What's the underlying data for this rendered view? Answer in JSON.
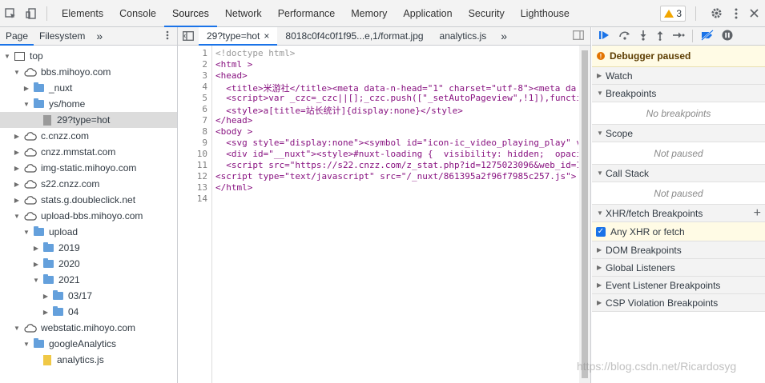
{
  "topbar": {
    "tabs": [
      "Elements",
      "Console",
      "Sources",
      "Network",
      "Performance",
      "Memory",
      "Application",
      "Security",
      "Lighthouse"
    ],
    "warning_count": "3"
  },
  "navigator": {
    "tabs": [
      "Page",
      "Filesystem"
    ],
    "more": "»",
    "tree": [
      {
        "label": "top",
        "type": "frame",
        "depth": 0,
        "open": true
      },
      {
        "label": "bbs.mihoyo.com",
        "type": "cloud",
        "depth": 1,
        "open": true
      },
      {
        "label": "_nuxt",
        "type": "folder",
        "depth": 2,
        "open": false
      },
      {
        "label": "ys/home",
        "type": "folder",
        "depth": 2,
        "open": true
      },
      {
        "label": "29?type=hot",
        "type": "file-gray",
        "depth": 3,
        "selected": true
      },
      {
        "label": "c.cnzz.com",
        "type": "cloud",
        "depth": 1,
        "open": false
      },
      {
        "label": "cnzz.mmstat.com",
        "type": "cloud",
        "depth": 1,
        "open": false
      },
      {
        "label": "img-static.mihoyo.com",
        "type": "cloud",
        "depth": 1,
        "open": false
      },
      {
        "label": "s22.cnzz.com",
        "type": "cloud",
        "depth": 1,
        "open": false
      },
      {
        "label": "stats.g.doubleclick.net",
        "type": "cloud",
        "depth": 1,
        "open": false
      },
      {
        "label": "upload-bbs.mihoyo.com",
        "type": "cloud",
        "depth": 1,
        "open": true
      },
      {
        "label": "upload",
        "type": "folder",
        "depth": 2,
        "open": true
      },
      {
        "label": "2019",
        "type": "folder",
        "depth": 3,
        "open": false
      },
      {
        "label": "2020",
        "type": "folder",
        "depth": 3,
        "open": false
      },
      {
        "label": "2021",
        "type": "folder",
        "depth": 3,
        "open": true
      },
      {
        "label": "03/17",
        "type": "folder",
        "depth": 4,
        "open": false
      },
      {
        "label": "04",
        "type": "folder",
        "depth": 4,
        "open": false
      },
      {
        "label": "webstatic.mihoyo.com",
        "type": "cloud",
        "depth": 1,
        "open": true
      },
      {
        "label": "googleAnalytics",
        "type": "folder",
        "depth": 2,
        "open": true
      },
      {
        "label": "analytics.js",
        "type": "file-yellow",
        "depth": 3
      }
    ]
  },
  "editor": {
    "tabs": [
      {
        "label": "29?type=hot",
        "active": true,
        "close": "×"
      },
      {
        "label": "8018c0f4c0f1f95...e,1/format.jpg",
        "active": false
      },
      {
        "label": "analytics.js",
        "active": false
      }
    ],
    "more": "»",
    "lines": [
      "<!doctype html>",
      "<html >",
      "<head>",
      "  <title>米游社</title><meta data-n-head=\"1\" charset=\"utf-8\"><meta da",
      "  <script>var _czc=_czc||[];_czc.push([\"_setAutoPageview\",!1]),functi",
      "  <style>a[title=站长统计]{display:none}</style>",
      "</head>",
      "<body >",
      "  <svg style=\"display:none\"><symbol id=\"icon-ic_video_playing_play\" v",
      "  <div id=\"__nuxt\"><style>#nuxt-loading {  visibility: hidden;  opaci",
      "  <script src=\"https://s22.cnzz.com/z_stat.php?id=1275023096&web_id=1",
      "<script type=\"text/javascript\" src=\"/_nuxt/861395a2f96f7985c257.js\">",
      "</html>",
      ""
    ]
  },
  "debugger": {
    "paused_label": "Debugger paused",
    "sections": [
      {
        "label": "Watch",
        "open": false
      },
      {
        "label": "Breakpoints",
        "open": true,
        "empty": "No breakpoints"
      },
      {
        "label": "Scope",
        "open": true,
        "empty": "Not paused"
      },
      {
        "label": "Call Stack",
        "open": true,
        "empty": "Not paused"
      },
      {
        "label": "XHR/fetch Breakpoints",
        "open": true,
        "checkbox": "Any XHR or fetch"
      },
      {
        "label": "DOM Breakpoints",
        "open": false
      },
      {
        "label": "Global Listeners",
        "open": false
      },
      {
        "label": "Event Listener Breakpoints",
        "open": false
      },
      {
        "label": "CSP Violation Breakpoints",
        "open": false
      }
    ]
  },
  "watermark": "https://blog.csdn.net/Ricardosyg",
  "colors": {
    "accent": "#1a73e8",
    "folder": "#64a0dc",
    "paused_bg": "#fffbe5"
  }
}
